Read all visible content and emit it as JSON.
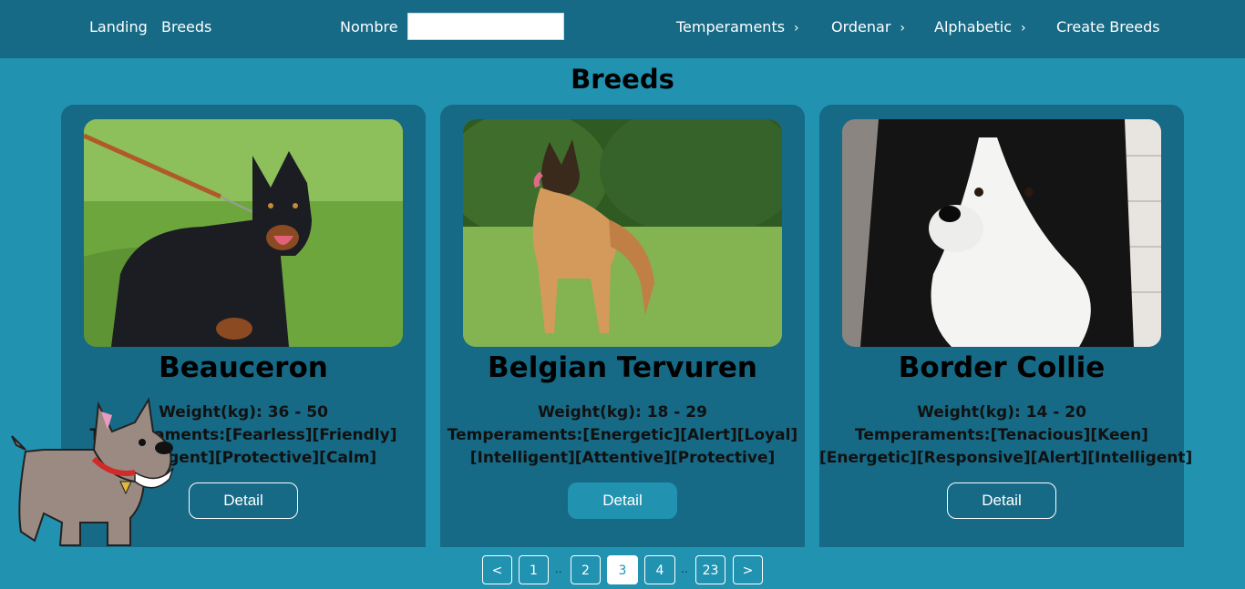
{
  "nav": {
    "landing": "Landing",
    "breeds": "Breeds",
    "search_label": "Nombre",
    "search_value": "",
    "temperaments": "Temperaments",
    "order": "Ordenar",
    "alphabetic": "Alphabetic",
    "create": "Create Breeds",
    "chevron": "›"
  },
  "page": {
    "title": "Breeds"
  },
  "cards": [
    {
      "name": "Beauceron",
      "weight": "Weight(kg): 36 - 50",
      "temper_line1": "Temperaments:[Fearless][Friendly]",
      "temper_line2": "[Intelligent][Protective][Calm]",
      "button": "Detail",
      "image": "black-and-tan-dog-on-leash-photo"
    },
    {
      "name": "Belgian Tervuren",
      "weight": "Weight(kg): 18 - 29",
      "temper_line1": "Temperaments:[Energetic][Alert][Loyal]",
      "temper_line2": "[Intelligent][Attentive][Protective]",
      "button": "Detail",
      "image": "fawn-shepherd-dog-on-grass-photo"
    },
    {
      "name": "Border Collie",
      "weight": "Weight(kg): 14 - 20",
      "temper_line1": "Temperaments:[Tenacious][Keen]",
      "temper_line2": "[Energetic][Responsive][Alert][Intelligent]",
      "button": "Detail",
      "image": "black-and-white-collie-portrait-photo"
    }
  ],
  "pagination": {
    "prev": "<",
    "pages": [
      "1",
      "2",
      "3",
      "4",
      "23"
    ],
    "current": "3",
    "ellipsis": "..",
    "next": ">"
  },
  "colors": {
    "background": "#2292b1",
    "navbar": "#166a86",
    "card": "#166a86",
    "active_button": "#2292b1"
  },
  "mascot": "cartoon-scottish-terrier-icon"
}
